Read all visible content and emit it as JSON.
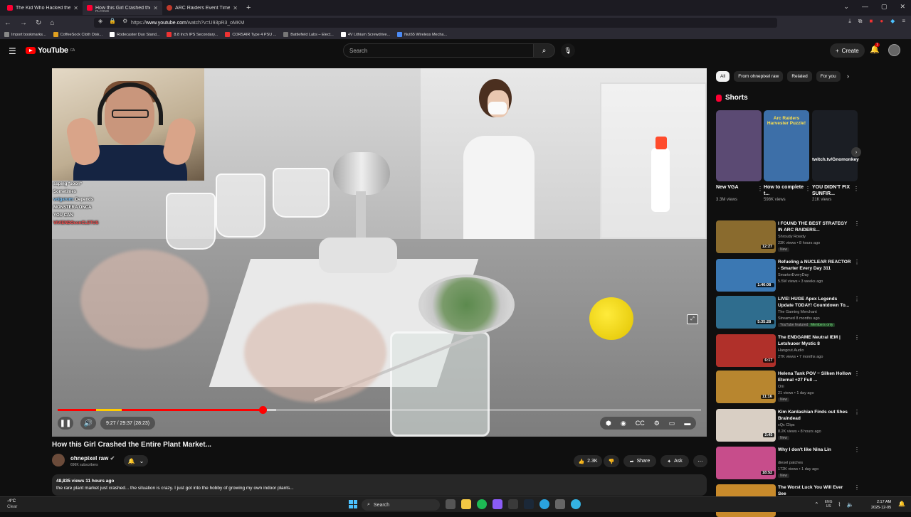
{
  "browser": {
    "tabs": [
      {
        "title": "The Kid Who Hacked the Penta",
        "sub": ""
      },
      {
        "title": "How this Girl Crashed the Entir",
        "sub": "PLAYING"
      },
      {
        "title": "ARC Raiders Event Timers | Me",
        "sub": ""
      }
    ],
    "url_prefix": "https://",
    "url_domain": "www.youtube.com",
    "url_path": "/watch?v=U93pR3_oMKM",
    "bookmarks": [
      "Import bookmarks...",
      "CoffeeSock Cloth Disk...",
      "Rodecaster Duo Stand...",
      "8.8 Inch IPS Secondary...",
      "CORSAIR Type 4 PSU ...",
      "Battlefield Labs – Elect...",
      "4V Lithium Screwdrive...",
      "Nut65 Wireless Mecha..."
    ]
  },
  "header": {
    "logo_text": "YouTube",
    "logo_region": "CA",
    "search_placeholder": "Search",
    "create_label": "Create",
    "notification_count": "1"
  },
  "player": {
    "chat": [
      {
        "user": "",
        "msg": "ssping *soon*",
        "cls": "p"
      },
      {
        "user": "",
        "msg": "Sometimes",
        "cls": ""
      },
      {
        "user": "volgarum:",
        "msg": "Depends",
        "cls": ""
      },
      {
        "user": "",
        "msg": "",
        "cls": "o"
      },
      {
        "user": "",
        "msg": "MONSTERA ONCA",
        "cls": "g"
      },
      {
        "user": "",
        "msg": "YOU CAN",
        "cls": "g"
      },
      {
        "user": "VIVIENDOconCLETUS",
        "msg": "",
        "cls": "r"
      }
    ],
    "time_text": "9:27 / 29:37 (28:23)",
    "progress_played": 0.319,
    "progress_buffered": 0.34
  },
  "video": {
    "title": "How this Girl Crashed the Entire Plant Market...",
    "channel": "ohnepixel raw",
    "subscribers": "696K subscribers",
    "likes": "2.3K",
    "share_label": "Share",
    "ask_label": "Ask",
    "views_time": "48,835 views  11 hours ago",
    "description": "the rare plant market just crashed... the situation is crazy. I just got into the hobby of growing my own indoor plants..."
  },
  "sidebar": {
    "chips": [
      "All",
      "From ohnepixel raw",
      "Related",
      "For you"
    ],
    "shorts_title": "Shorts",
    "shorts": [
      {
        "title": "New VGA",
        "views": "3.3M views",
        "color": "#5b4a73"
      },
      {
        "title": "How to complete t...",
        "views": "598K views",
        "color": "#3d6fa8",
        "overlay": "Arc Raiders Harvester Puzzle!"
      },
      {
        "title": "YOU DIDN'T FIX SUNFIR...",
        "views": "21K views",
        "color": "#1b1e24",
        "overlay": "twitch.tv/Gnomonkey"
      }
    ],
    "recs": [
      {
        "title": "I FOUND THE BEST STRATEGY IN ARC RAIDERS...",
        "channel": "Shroudy Rowdy",
        "meta": "23K views • 8 hours ago",
        "badge": "New",
        "dur": "12:27",
        "color": "#8a6b2e"
      },
      {
        "title": "Refueling a NUCLEAR REACTOR - Smarter Every Day 311",
        "channel": "SmarterEveryDay",
        "meta": "5.5M views • 3 weeks ago",
        "badge": "",
        "dur": "1:46:08",
        "color": "#3b78b3"
      },
      {
        "title": "LIVE! HUGE Apex Legends Update TODAY! Countdown To...",
        "channel": "The Gaming Merchant",
        "meta": "Streamed 8 months ago",
        "badge": "YouTube featured",
        "badge2": "Members only",
        "dur": "5:35:28",
        "color": "#2f6d8e"
      },
      {
        "title": "The ENDGAME Neutral IEM | Letshuoer Mystic 8",
        "channel": "Hangout.Audio",
        "meta": "27K views • 7 months ago",
        "badge": "",
        "dur": "6:17",
        "color": "#b0302a"
      },
      {
        "title": "Helena Tank POV ~ Silken Hollow Eternal +27 Full ...",
        "channel": "Orii",
        "meta": "21 views • 1 day ago",
        "badge": "New",
        "dur": "11:16",
        "color": "#b8862f"
      },
      {
        "title": "Kim Kardashian Finds out Shes Braindead",
        "channel": "xQc Clips",
        "meta": "8.2K views • 8 hours ago",
        "badge": "New",
        "dur": "2:45",
        "color": "#d9cfc4"
      },
      {
        "title": "Why I don't like Nina Lin",
        "channel": "diesel patches",
        "meta": "172K views • 1 day ago",
        "badge": "New",
        "dur": "18:52",
        "color": "#c74d8b"
      },
      {
        "title": "The Worst Luck You Will Ever See",
        "channel": "",
        "meta": "",
        "badge": "",
        "dur": "",
        "color": "#c88a2b"
      }
    ]
  },
  "taskbar": {
    "temp": "-4°C",
    "weather": "Clear",
    "search_label": "Search",
    "lang": "ENG",
    "region": "US",
    "time": "2:17 AM",
    "date": "2025-12-05"
  }
}
